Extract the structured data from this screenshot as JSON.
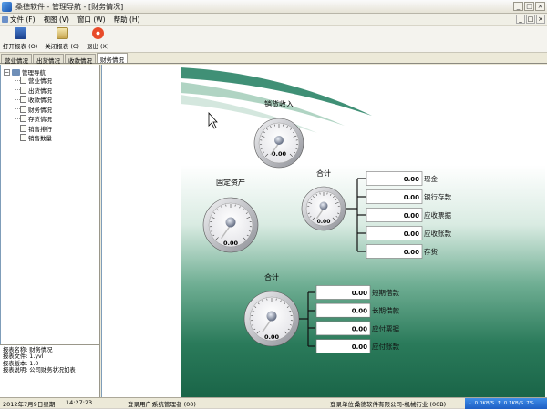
{
  "window": {
    "title": "桑德软件 - 管理导航 - [财务情况]",
    "controls": [
      "_",
      "□",
      "×"
    ]
  },
  "menubar": {
    "items": [
      "文件 (F)",
      "视图 (V)",
      "窗口 (W)",
      "帮助 (H)"
    ],
    "mdi_controls": [
      "_",
      "□",
      "×"
    ]
  },
  "toolbar": {
    "open_label": "打开报表 (O)",
    "close_label": "关闭报表 (C)",
    "exit_label": "退出 (X)"
  },
  "tabs": [
    "营业情况",
    "出货情况",
    "收款情况",
    "财务情况"
  ],
  "tree": {
    "root": "管理导航",
    "items": [
      "营业情况",
      "出货情况",
      "收款情况",
      "财务情况",
      "存货情况",
      "销售排行",
      "销售数量"
    ]
  },
  "info_panel": {
    "line1": "报表名称: 财务情况",
    "line2": "报表文件: 1.yvl",
    "line3": "报表版本: 1.0",
    "line4": "报表说明: 公司财务状况如表"
  },
  "dashboard": {
    "gauges": {
      "sales_income": {
        "title": "销货收入",
        "value": "0.00"
      },
      "fixed_assets": {
        "title": "固定资产",
        "value": "0.00"
      },
      "total_assets": {
        "title": "合计",
        "value": "0.00"
      },
      "total_liabilities": {
        "title": "合计",
        "value": "0.00"
      }
    },
    "asset_rows": [
      {
        "value": "0.00",
        "label": "现金"
      },
      {
        "value": "0.00",
        "label": "银行存款"
      },
      {
        "value": "0.00",
        "label": "应收票据"
      },
      {
        "value": "0.00",
        "label": "应收账款"
      },
      {
        "value": "0.00",
        "label": "存货"
      }
    ],
    "liability_rows": [
      {
        "value": "0.00",
        "label": "短期借款"
      },
      {
        "value": "0.00",
        "label": "长期借款"
      },
      {
        "value": "0.00",
        "label": "应付票据"
      },
      {
        "value": "0.00",
        "label": "应付账款"
      }
    ]
  },
  "statusbar": {
    "date": "2012年7月9日星期一",
    "time": "14:27:23",
    "user_label": "登录用户：",
    "user": "系统管理者 (00)",
    "unit_label": "登录单位：",
    "unit": "桑德软件有限公司-机械行业 (00B)"
  },
  "tray": {
    "down": "0.0KB/S",
    "up": "0.1KB/S",
    "pct": "7%"
  },
  "colors": {
    "titlebar": "#f0efe6",
    "canvas_top": "#ffffff",
    "canvas_bottom": "#1a6548",
    "tray": "#1e5fc4"
  }
}
